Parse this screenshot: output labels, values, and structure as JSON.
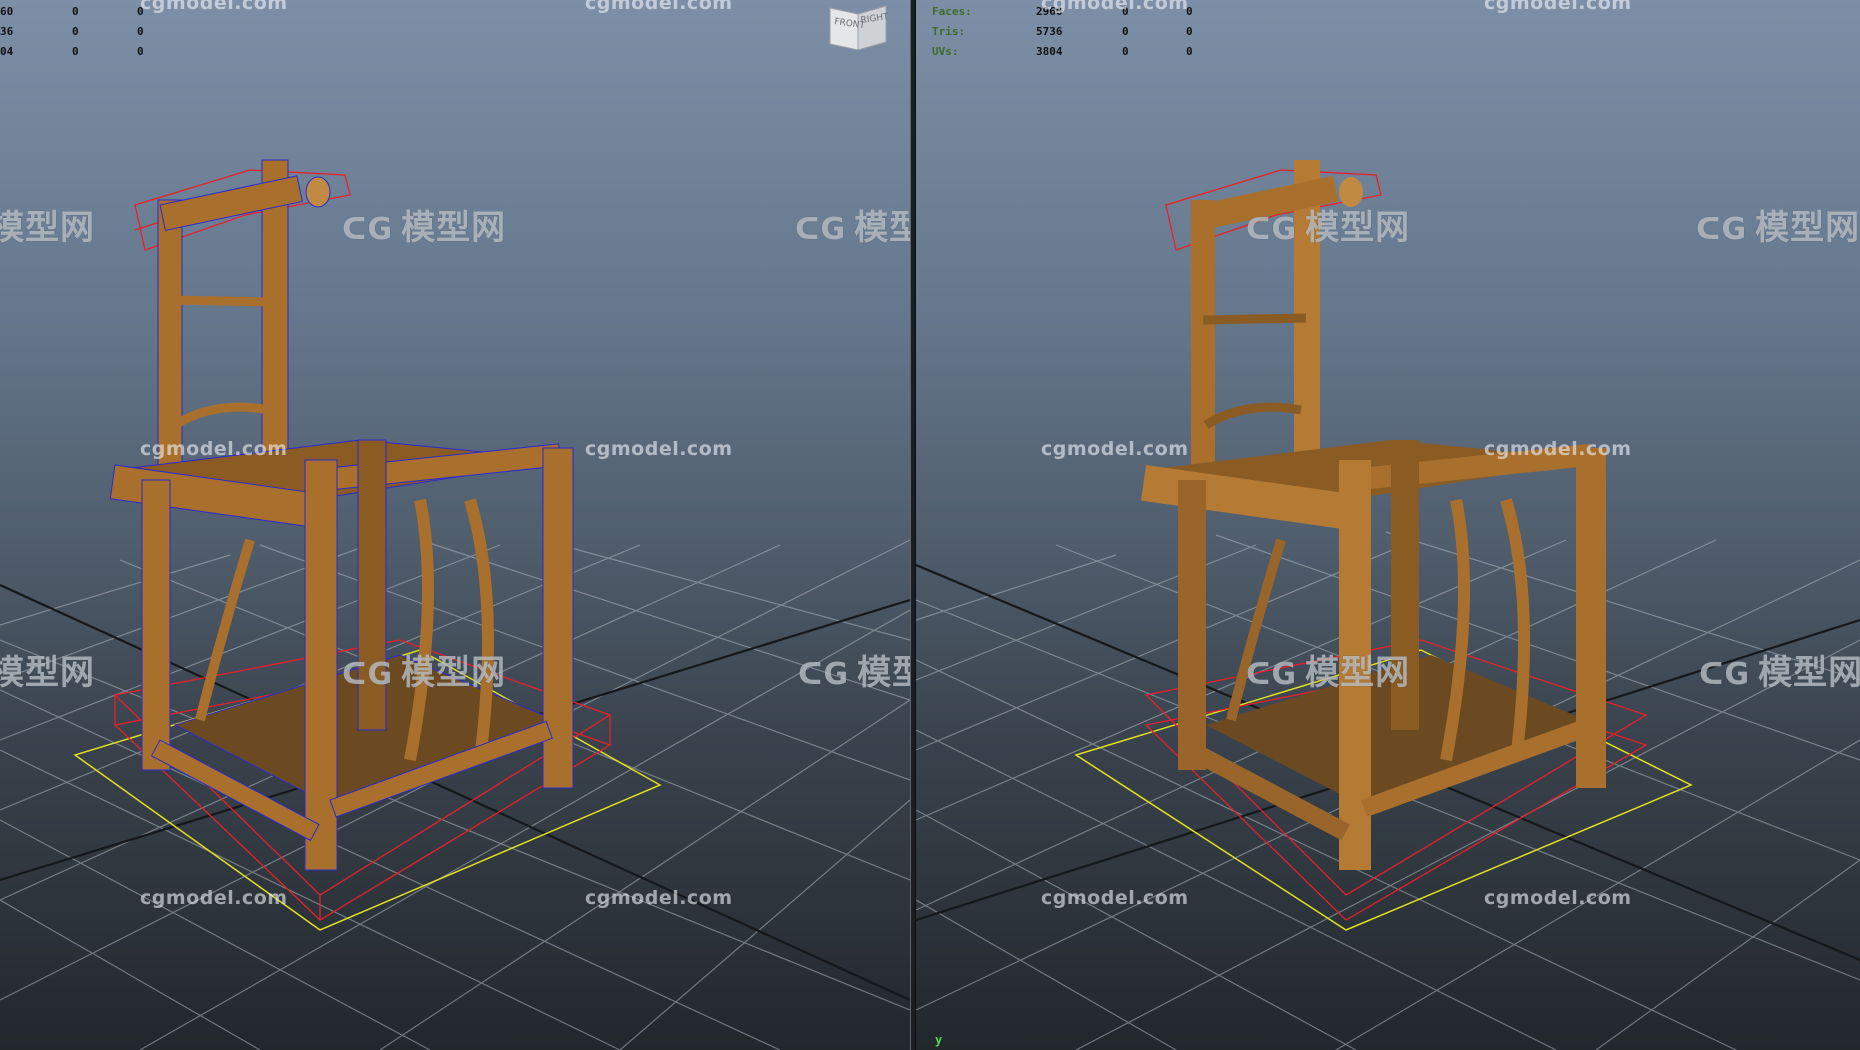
{
  "left_viewport": {
    "stats": [
      {
        "label": "",
        "v1": "60",
        "v2": "0",
        "v3": "0"
      },
      {
        "label": "",
        "v1": "36",
        "v2": "0",
        "v3": "0"
      },
      {
        "label": "",
        "v1": "04",
        "v2": "0",
        "v3": "0"
      }
    ],
    "display_mode": "wireframe-on-shaded",
    "view_cube": {
      "front": "FRONT",
      "right": "RIGHT"
    }
  },
  "right_viewport": {
    "stats": [
      {
        "label": "Faces:",
        "v1": "2960",
        "v2": "0",
        "v3": "0"
      },
      {
        "label": "Tris:",
        "v1": "5736",
        "v2": "0",
        "v3": "0"
      },
      {
        "label": "UVs:",
        "v1": "3804",
        "v2": "0",
        "v3": "0"
      }
    ],
    "display_mode": "smooth-shaded",
    "axis_label": "y"
  },
  "watermarks": {
    "brand_cn": "模型网",
    "logo_glyph": "ᑕG",
    "url": "cgmodel.com"
  },
  "colors": {
    "wood": "#a8702c",
    "wood_dark": "#6e4417",
    "wire": "#2a2ad0",
    "bbox": "#e8202a",
    "ground_select": "#e0e020",
    "grid": "#b8bec6"
  }
}
